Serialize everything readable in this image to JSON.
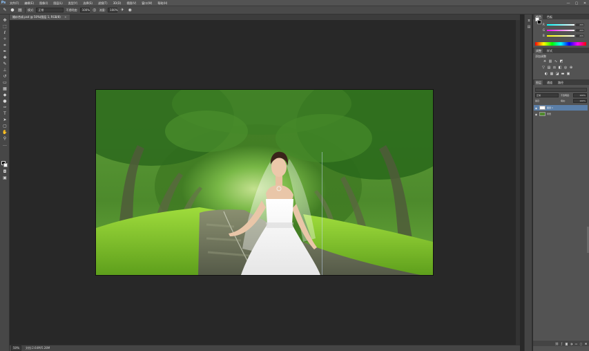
{
  "app": {
    "logo": "Ps"
  },
  "menu": [
    "文件(F)",
    "编辑(E)",
    "图像(I)",
    "图层(L)",
    "类型(Y)",
    "选择(S)",
    "滤镜(T)",
    "3D(D)",
    "视图(V)",
    "窗口(W)",
    "帮助(H)"
  ],
  "window_controls": [
    "—",
    "▢",
    "✕"
  ],
  "options": {
    "mode_label": "模式:",
    "mode_value": "正常",
    "opacity_label": "不透明度:",
    "opacity_value": "100%",
    "flow_label": "流量:",
    "flow_value": "100%"
  },
  "tab": {
    "title": "婚纱合成.psd @ 50%(图层 1, RGB/8)",
    "close": "×"
  },
  "status": {
    "zoom": "50%",
    "info": "文档:2.64M/5.28M"
  },
  "panels": {
    "color_tabs": [
      "颜色",
      "色板"
    ],
    "sliders": [
      {
        "letter": "R",
        "value": "255",
        "color": "linear-gradient(to right,#0ff,#fff)"
      },
      {
        "letter": "G",
        "value": "255",
        "color": "linear-gradient(to right,#f0f,#fff)"
      },
      {
        "letter": "B",
        "value": "255",
        "color": "linear-gradient(to right,#ff0,#fff)"
      }
    ],
    "adjust_tabs": [
      "调整",
      "样式"
    ],
    "adjust_title": "添加调整",
    "layers_tabs": [
      "图层",
      "通道",
      "路径"
    ],
    "layer_mode": "正常",
    "opacity_label": "不透明度:",
    "opacity_value": "100%",
    "lock_label": "锁定:",
    "fill_label": "填充:",
    "fill_value": "100%",
    "layers": [
      {
        "name": "图层 1",
        "selected": true
      },
      {
        "name": "背景",
        "selected": false
      }
    ]
  }
}
